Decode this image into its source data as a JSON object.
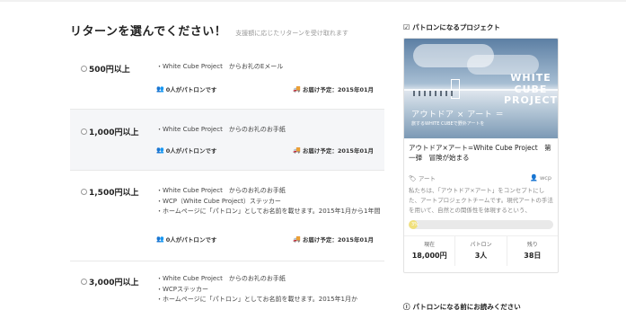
{
  "main": {
    "title": "リターンを選んでください！",
    "subtitle": "支援額に応じたリターンを受け取れます"
  },
  "rewards": [
    {
      "price": "500円以上",
      "lines": [
        "・White Cube Project　からお礼のEメール"
      ],
      "backers": "0人がパトロンです",
      "delivery": "お届け予定：2015年01月"
    },
    {
      "price": "1,000円以上",
      "lines": [
        "・White Cube Project　からのお礼のお手紙"
      ],
      "backers": "0人がパトロンです",
      "delivery": "お届け予定：2015年01月"
    },
    {
      "price": "1,500円以上",
      "lines": [
        "・White Cube Project　からのお礼のお手紙",
        "・WCP（White Cube Project）ステッカー",
        "・ホームページに「パトロン」としてお名前を載せます。2015年1月から1年間"
      ],
      "backers": "0人がパトロンです",
      "delivery": "お届け予定：2015年01月"
    },
    {
      "price": "3,000円以上",
      "lines": [
        "・White Cube Project　からのお礼のお手紙",
        "・WCPステッカー",
        "・ホームページに「パトロン」としてお名前を載せます。2015年1月か"
      ],
      "backers": "",
      "delivery": ""
    }
  ],
  "side": {
    "heading": "パトロンになるプロジェクト",
    "hero": {
      "jp": "アウトドア × アート ＝",
      "tag": "旅するWHITE CUBEで野外アートを",
      "wcp": "WHITE CUBE PROJECT"
    },
    "card_title": "アウトドア×アート=White Cube Project　第一弾　冒険が始まる",
    "category": "アート",
    "owner": "wcp",
    "description": "私たちは、「アウトドア×アート」をコンセプトにした、アートプロジェクトチームです。現代アートの手法を用いて、自然との関係性を体現するという、",
    "progress_label": "3%",
    "progress": 0.03,
    "stats": [
      {
        "label": "現在",
        "value": "18,000円"
      },
      {
        "label": "パトロン",
        "value": "3人"
      },
      {
        "label": "残り",
        "value": "38日"
      }
    ],
    "heading2": "パトロンになる前にお読みください"
  },
  "colors": {
    "progress_fill": "#f0e07c",
    "alt_row": "#f5f6f8"
  }
}
